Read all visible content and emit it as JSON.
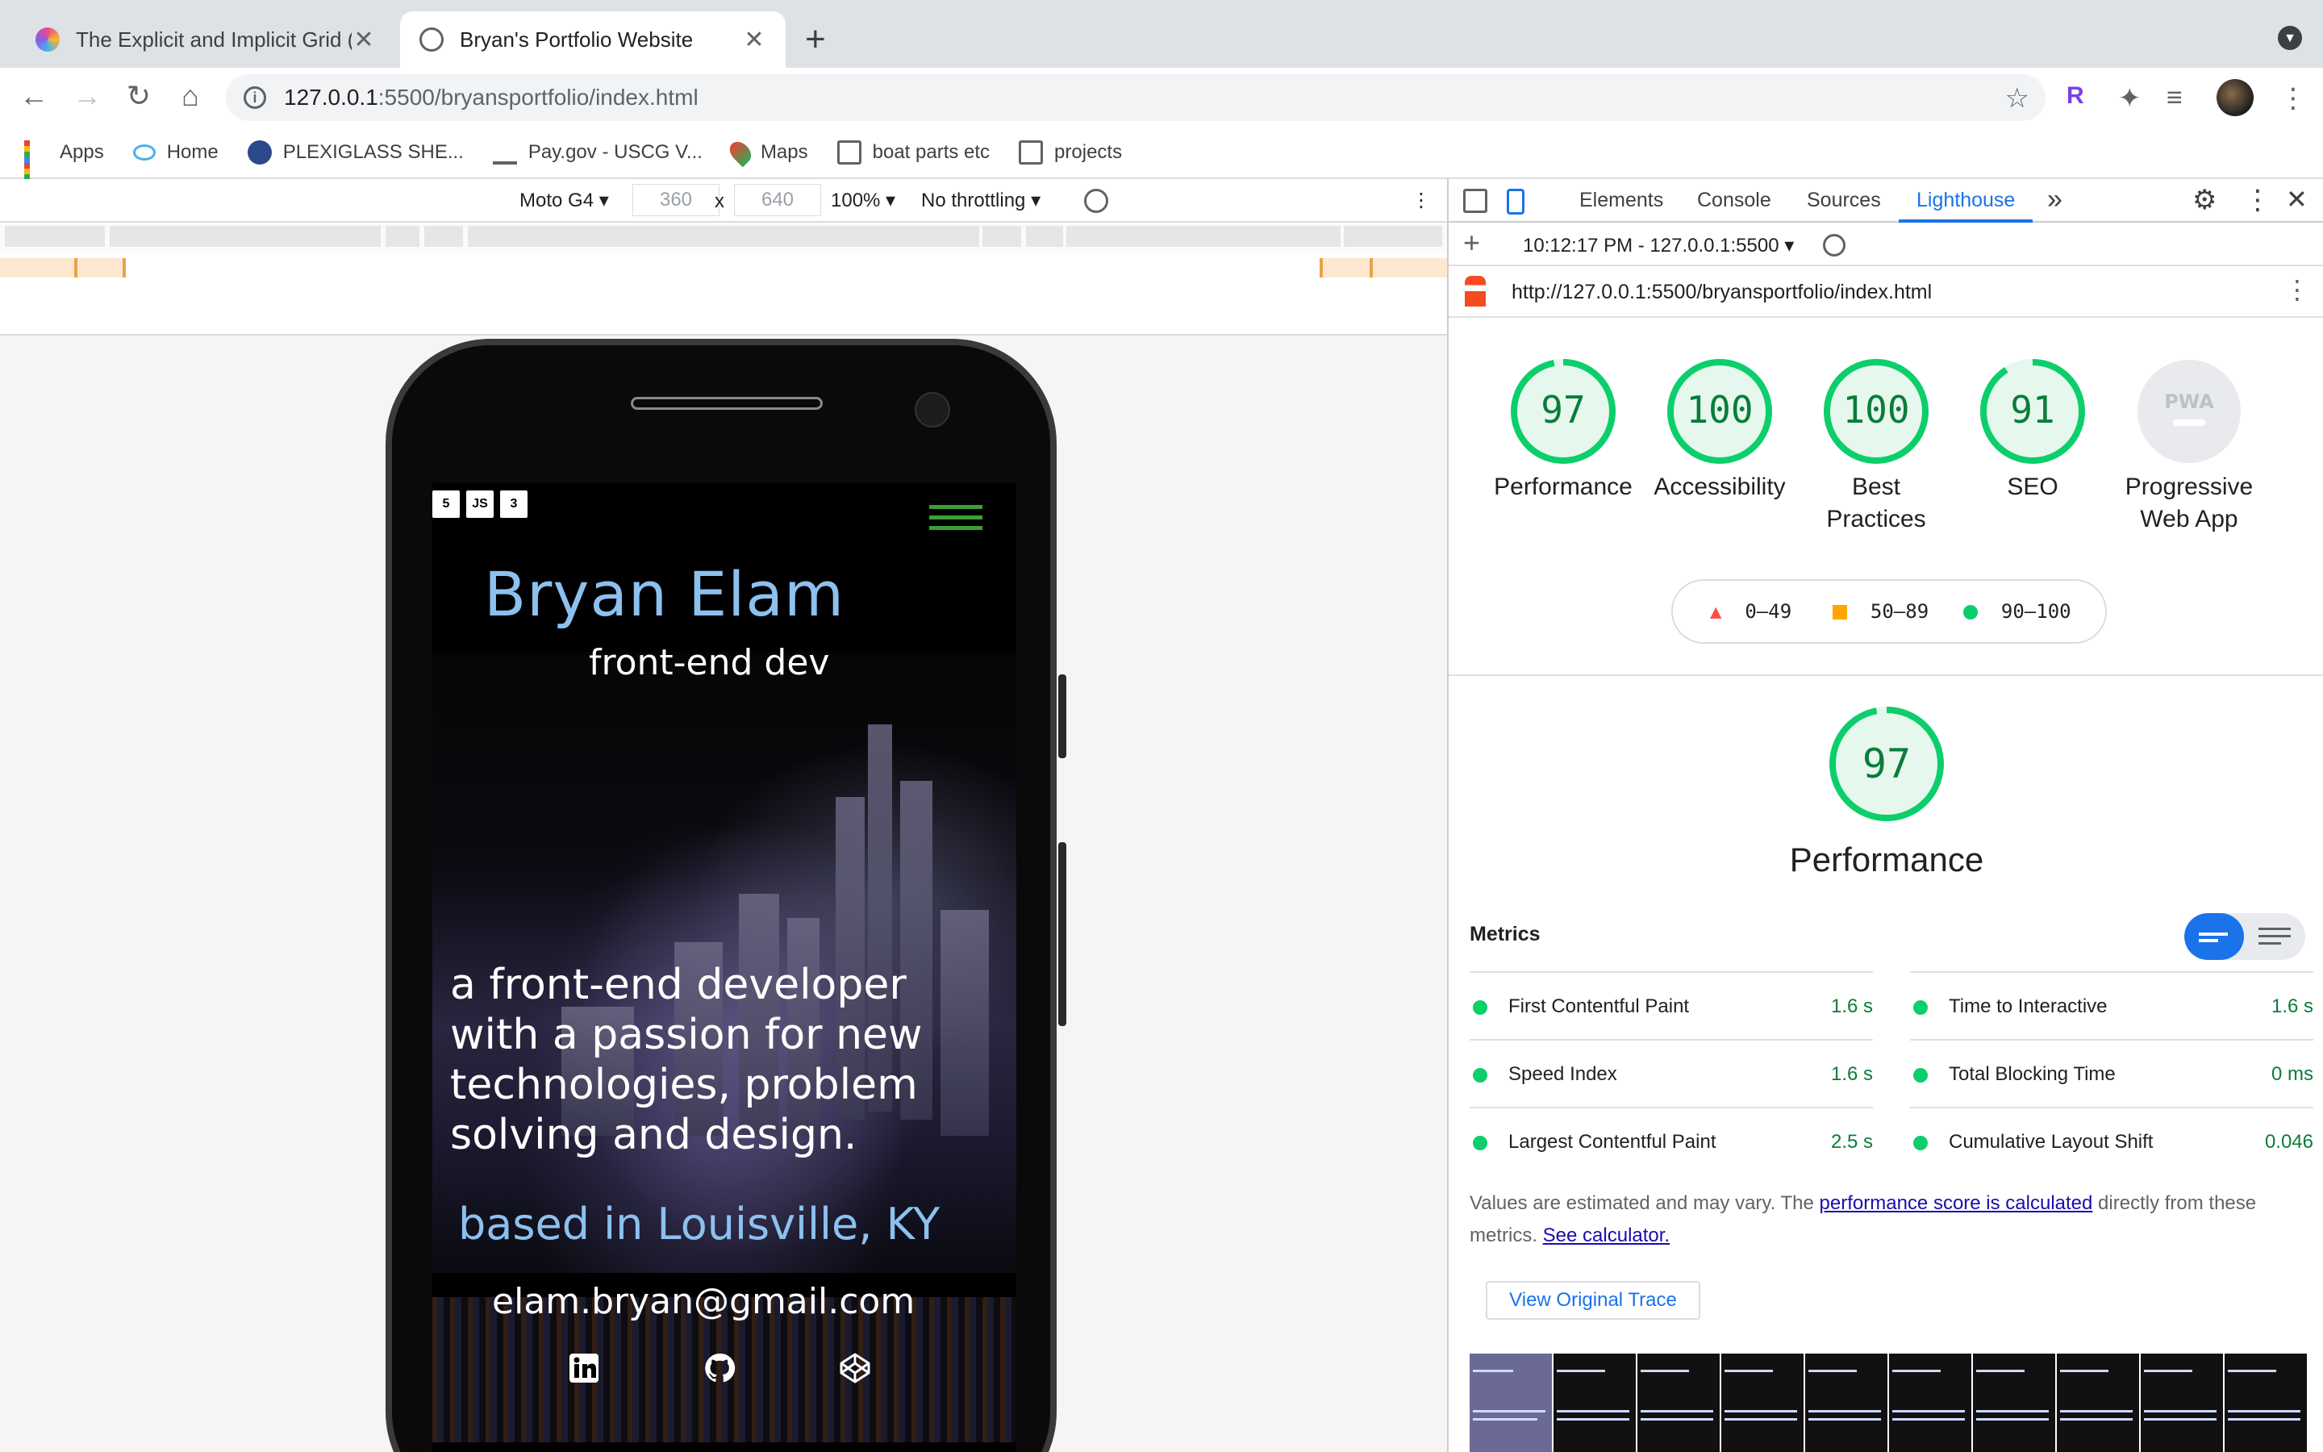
{
  "browser": {
    "tabs": [
      {
        "title": "The Explicit and Implicit Grid (I",
        "active": false
      },
      {
        "title": "Bryan's Portfolio Website",
        "active": true
      }
    ],
    "new_tab_label": "+",
    "close_glyph": "✕",
    "url_host": "127.0.0.1",
    "url_rest": ":5500/bryansportfolio/index.html",
    "bookmarks": [
      {
        "label": "Apps",
        "icon": "apps-grid-icon"
      },
      {
        "label": "Home",
        "icon": "home-eye-icon"
      },
      {
        "label": "PLEXIGLASS SHE...",
        "icon": "globe-icon"
      },
      {
        "label": "Pay.gov - USCG V...",
        "icon": "eagle-icon"
      },
      {
        "label": "Maps",
        "icon": "maps-pin-icon"
      },
      {
        "label": "boat parts etc",
        "icon": "folder-icon"
      },
      {
        "label": "projects",
        "icon": "folder-icon"
      }
    ]
  },
  "device_toolbar": {
    "device": "Moto G4",
    "width": "360",
    "height": "640",
    "times": "x",
    "zoom": "100%",
    "throttling": "No throttling"
  },
  "portfolio": {
    "tech_logos": [
      "5",
      "JS",
      "3"
    ],
    "name": "Bryan Elam",
    "role": "front-end dev",
    "bio": "a front-end developer with a passion for new technologies, problem solving and design.",
    "location": "based in Louisville, KY",
    "email": "elam.bryan@gmail.com",
    "social": [
      "linkedin-icon",
      "github-icon",
      "codepen-icon"
    ]
  },
  "devtools": {
    "tabs": [
      "Elements",
      "Console",
      "Sources",
      "Lighthouse"
    ],
    "active_tab": "Lighthouse",
    "more_tabs": "»",
    "report_time": "10:12:17 PM - 127.0.0.1:5500",
    "report_url": "http://127.0.0.1:5500/bryansportfolio/index.html",
    "scores": [
      {
        "label": "Performance",
        "score": 97
      },
      {
        "label": "Accessibility",
        "score": 100
      },
      {
        "label": "Best Practices",
        "score": 100
      },
      {
        "label": "SEO",
        "score": 91
      },
      {
        "label": "Progressive Web App",
        "score": null,
        "badge": "PWA"
      }
    ],
    "legend": [
      "0–49",
      "50–89",
      "90–100"
    ],
    "colors": {
      "pass": "#0cce6b",
      "average": "#ffa400",
      "fail": "#ff4e42",
      "accent": "#1a73e8"
    },
    "performance": {
      "score": 97,
      "title": "Performance"
    },
    "metrics_heading": "Metrics",
    "metrics": [
      {
        "name": "First Contentful Paint",
        "value": "1.6 s"
      },
      {
        "name": "Time to Interactive",
        "value": "1.6 s"
      },
      {
        "name": "Speed Index",
        "value": "1.6 s"
      },
      {
        "name": "Total Blocking Time",
        "value": "0 ms"
      },
      {
        "name": "Largest Contentful Paint",
        "value": "2.5 s"
      },
      {
        "name": "Cumulative Layout Shift",
        "value": "0.046"
      }
    ],
    "note_prefix": "Values are estimated and may vary. The ",
    "note_link1": "performance score is calculated",
    "note_middle": " directly from these metrics. ",
    "note_link2": "See calculator.",
    "trace_button": "View Original Trace"
  }
}
